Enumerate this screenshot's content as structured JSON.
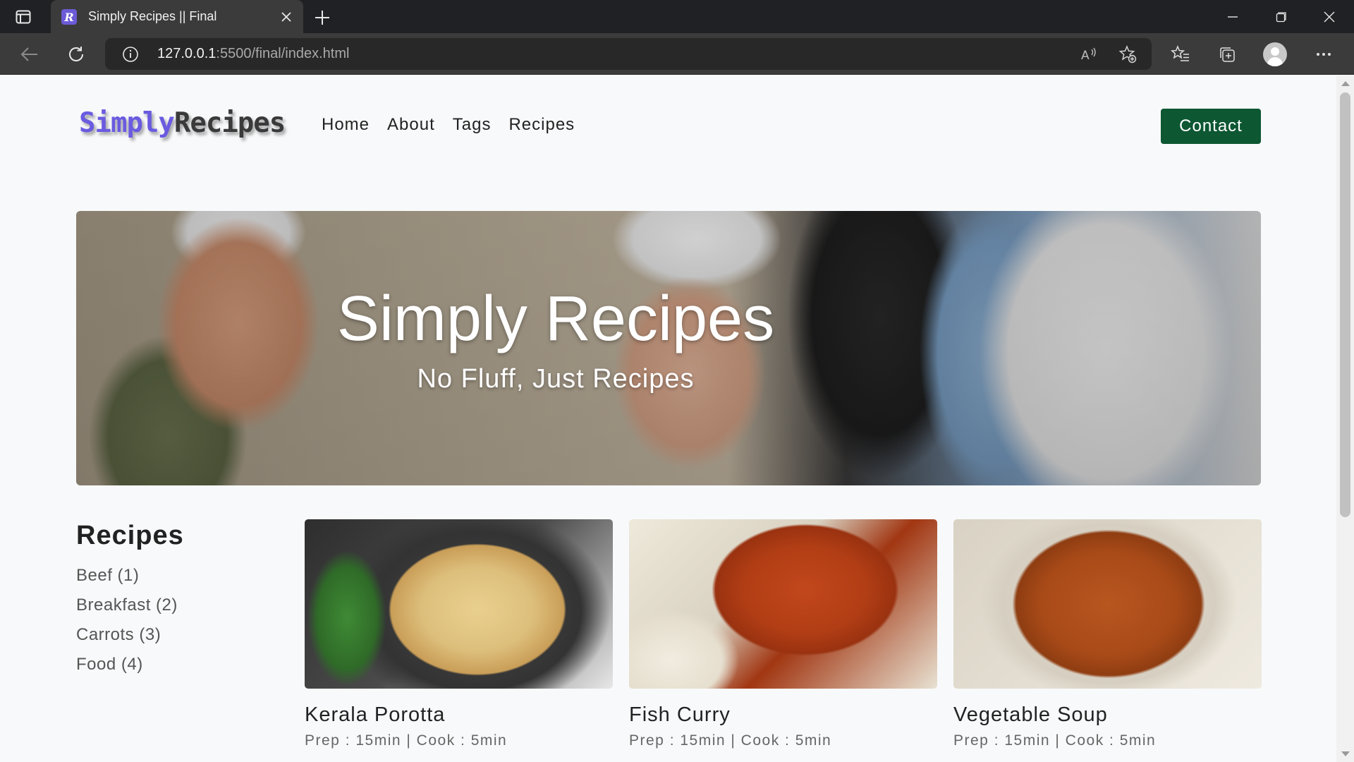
{
  "browser": {
    "tab_title": "Simply Recipes || Final",
    "tab_favicon_letter": "R",
    "url_host": "127.0.0.1",
    "url_rest": ":5500/final/index.html"
  },
  "site": {
    "logo_part1": "Simply",
    "logo_part2": "Recipes",
    "nav": [
      "Home",
      "About",
      "Tags",
      "Recipes"
    ],
    "contact_label": "Contact",
    "brand_color": "#6a5be0",
    "button_color": "#0d5733"
  },
  "hero": {
    "title": "Simply Recipes",
    "subtitle": "No Fluff, Just Recipes"
  },
  "tags": {
    "title": "Recipes",
    "items": [
      "Beef (1)",
      "Breakfast (2)",
      "Carrots (3)",
      "Food (4)"
    ]
  },
  "recipes": [
    {
      "title": "Kerala Porotta",
      "meta": "Prep : 15min | Cook : 5min",
      "image_icon": "porotta-image"
    },
    {
      "title": "Fish Curry",
      "meta": "Prep : 15min | Cook : 5min",
      "image_icon": "fish-curry-image"
    },
    {
      "title": "Vegetable Soup",
      "meta": "Prep : 15min | Cook : 5min",
      "image_icon": "vegetable-soup-image"
    }
  ]
}
